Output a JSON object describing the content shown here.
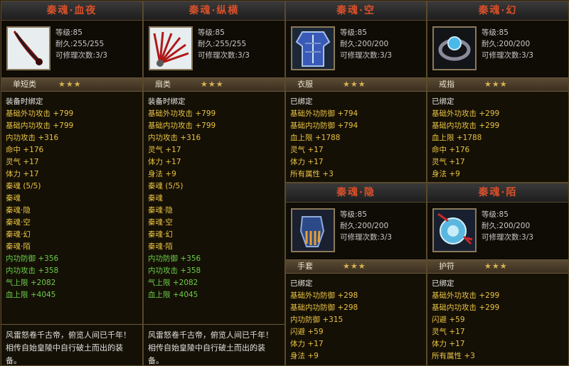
{
  "cards": [
    {
      "title": "秦魂·血夜",
      "level": "等级:85",
      "durability": "耐久:255/255",
      "repair": "可修理次数:3/3",
      "type": "单短类",
      "stars": "★★★",
      "attrs": [
        {
          "t": "装备时绑定"
        },
        {
          "t": "基础外功攻击 +799"
        },
        {
          "t": "基础内功攻击 +799"
        },
        {
          "t": "内功攻击 +316"
        },
        {
          "t": "命中 +176"
        },
        {
          "t": "灵气 +17"
        },
        {
          "t": "体力 +17"
        },
        {
          "t": "秦魂 (5/5)"
        },
        {
          "t": "秦魂"
        },
        {
          "t": "秦魂·隐"
        },
        {
          "t": "秦魂·空"
        },
        {
          "t": "秦魂·幻"
        },
        {
          "t": "秦魂·陌"
        },
        {
          "t": "内功防御 +356"
        },
        {
          "t": "内功攻击 +358"
        },
        {
          "t": "气上限 +2082"
        },
        {
          "t": "血上限 +4045"
        }
      ],
      "description": "风雷怒卷千古帝，俯览人间已千年！相传自始皇陵中自行破土而出的装备。"
    },
    {
      "title": "秦魂·纵横",
      "level": "等级:85",
      "durability": "耐久:255/255",
      "repair": "可修理次数:3/3",
      "type": "扇类",
      "stars": "★★★",
      "attrs": [
        {
          "t": "装备时绑定"
        },
        {
          "t": "基础外功攻击 +799"
        },
        {
          "t": "基础内功攻击 +799"
        },
        {
          "t": "内功攻击 +316"
        },
        {
          "t": "灵气 +17"
        },
        {
          "t": "体力 +17"
        },
        {
          "t": "身法 +9"
        },
        {
          "t": "秦魂 (5/5)"
        },
        {
          "t": "秦魂"
        },
        {
          "t": "秦魂·隐"
        },
        {
          "t": "秦魂·空"
        },
        {
          "t": "秦魂·幻"
        },
        {
          "t": "秦魂·陌"
        },
        {
          "t": "内功防御 +356"
        },
        {
          "t": "内功攻击 +358"
        },
        {
          "t": "气上限 +2082"
        },
        {
          "t": "血上限 +4045"
        }
      ],
      "description": "风雷怒卷千古帝，俯览人间已千年！相传自始皇陵中自行破土而出的装备。"
    },
    {
      "title": "秦魂·空",
      "level": "等级:85",
      "durability": "耐久:200/200",
      "repair": "可修理次数:3/3",
      "type": "衣服",
      "stars": "★★★",
      "attrs": [
        {
          "t": "已绑定"
        },
        {
          "t": "基础外功防御 +794"
        },
        {
          "t": "基础内功防御 +794"
        },
        {
          "t": "血上限 +1788"
        },
        {
          "t": "灵气 +17"
        },
        {
          "t": "体力 +17"
        },
        {
          "t": "所有属性 +3"
        }
      ]
    },
    {
      "title": "秦魂·幻",
      "level": "等级:85",
      "durability": "耐久:200/200",
      "repair": "可修理次数:3/3",
      "type": "戒指",
      "stars": "★★★",
      "attrs": [
        {
          "t": "已绑定"
        },
        {
          "t": "基础外功攻击 +299"
        },
        {
          "t": "基础内功攻击 +299"
        },
        {
          "t": "血上限 +1788"
        },
        {
          "t": "命中 +176"
        },
        {
          "t": "灵气 +17"
        },
        {
          "t": "身法 +9"
        }
      ]
    },
    {
      "title": "秦魂·隐",
      "level": "等级:85",
      "durability": "耐久:200/200",
      "repair": "可修理次数:3/3",
      "type": "手套",
      "stars": "★★★",
      "attrs": [
        {
          "t": "已绑定"
        },
        {
          "t": "基础外功防御 +298"
        },
        {
          "t": "基础内功防御 +298"
        },
        {
          "t": "内功防御 +315"
        },
        {
          "t": "闪避 +59"
        },
        {
          "t": "体力 +17"
        },
        {
          "t": "身法 +9"
        }
      ]
    },
    {
      "title": "秦魂·陌",
      "level": "等级:85",
      "durability": "耐久:200/200",
      "repair": "可修理次数:3/3",
      "type": "护符",
      "stars": "★★★",
      "attrs": [
        {
          "t": "已绑定"
        },
        {
          "t": "基础外功攻击 +299"
        },
        {
          "t": "基础内功攻击 +299"
        },
        {
          "t": "闪避 +59"
        },
        {
          "t": "灵气 +17"
        },
        {
          "t": "体力 +17"
        },
        {
          "t": "所有属性 +3"
        }
      ]
    }
  ]
}
